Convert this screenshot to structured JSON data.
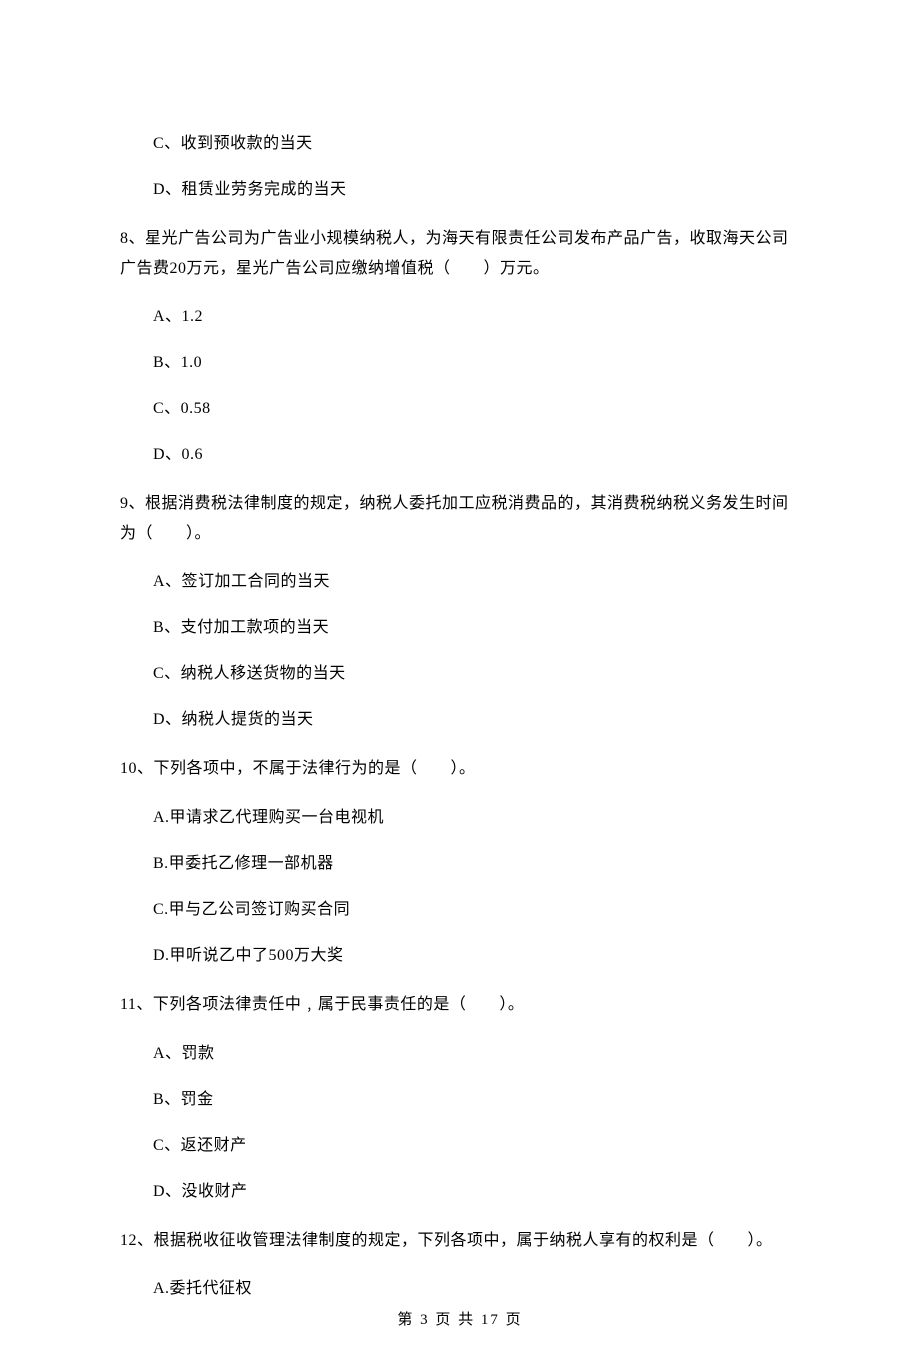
{
  "q7_continued": {
    "options": {
      "C": "C、收到预收款的当天",
      "D": "D、租赁业劳务完成的当天"
    }
  },
  "q8": {
    "stem": "8、星光广告公司为广告业小规模纳税人，为海天有限责任公司发布产品广告，收取海天公司广告费20万元，星光广告公司应缴纳增值税（　　）万元。",
    "options": {
      "A": "A、1.2",
      "B": "B、1.0",
      "C": "C、0.58",
      "D": "D、0.6"
    }
  },
  "q9": {
    "stem": "9、根据消费税法律制度的规定，纳税人委托加工应税消费品的，其消费税纳税义务发生时间为（　　）。",
    "options": {
      "A": "A、签订加工合同的当天",
      "B": "B、支付加工款项的当天",
      "C": "C、纳税人移送货物的当天",
      "D": "D、纳税人提货的当天"
    }
  },
  "q10": {
    "stem": "10、下列各项中，不属于法律行为的是（　　）。",
    "options": {
      "A": "A.甲请求乙代理购买一台电视机",
      "B": "B.甲委托乙修理一部机器",
      "C": "C.甲与乙公司签订购买合同",
      "D": "D.甲听说乙中了500万大奖"
    }
  },
  "q11": {
    "stem": "11、下列各项法律责任中﹐属于民事责任的是（　　）。",
    "options": {
      "A": "A、罚款",
      "B": "B、罚金",
      "C": "C、返还财产",
      "D": "D、没收财产"
    }
  },
  "q12": {
    "stem": "12、根据税收征收管理法律制度的规定，下列各项中，属于纳税人享有的权利是（　　）。",
    "options": {
      "A": "A.委托代征权"
    }
  },
  "footer": "第 3 页 共 17 页"
}
